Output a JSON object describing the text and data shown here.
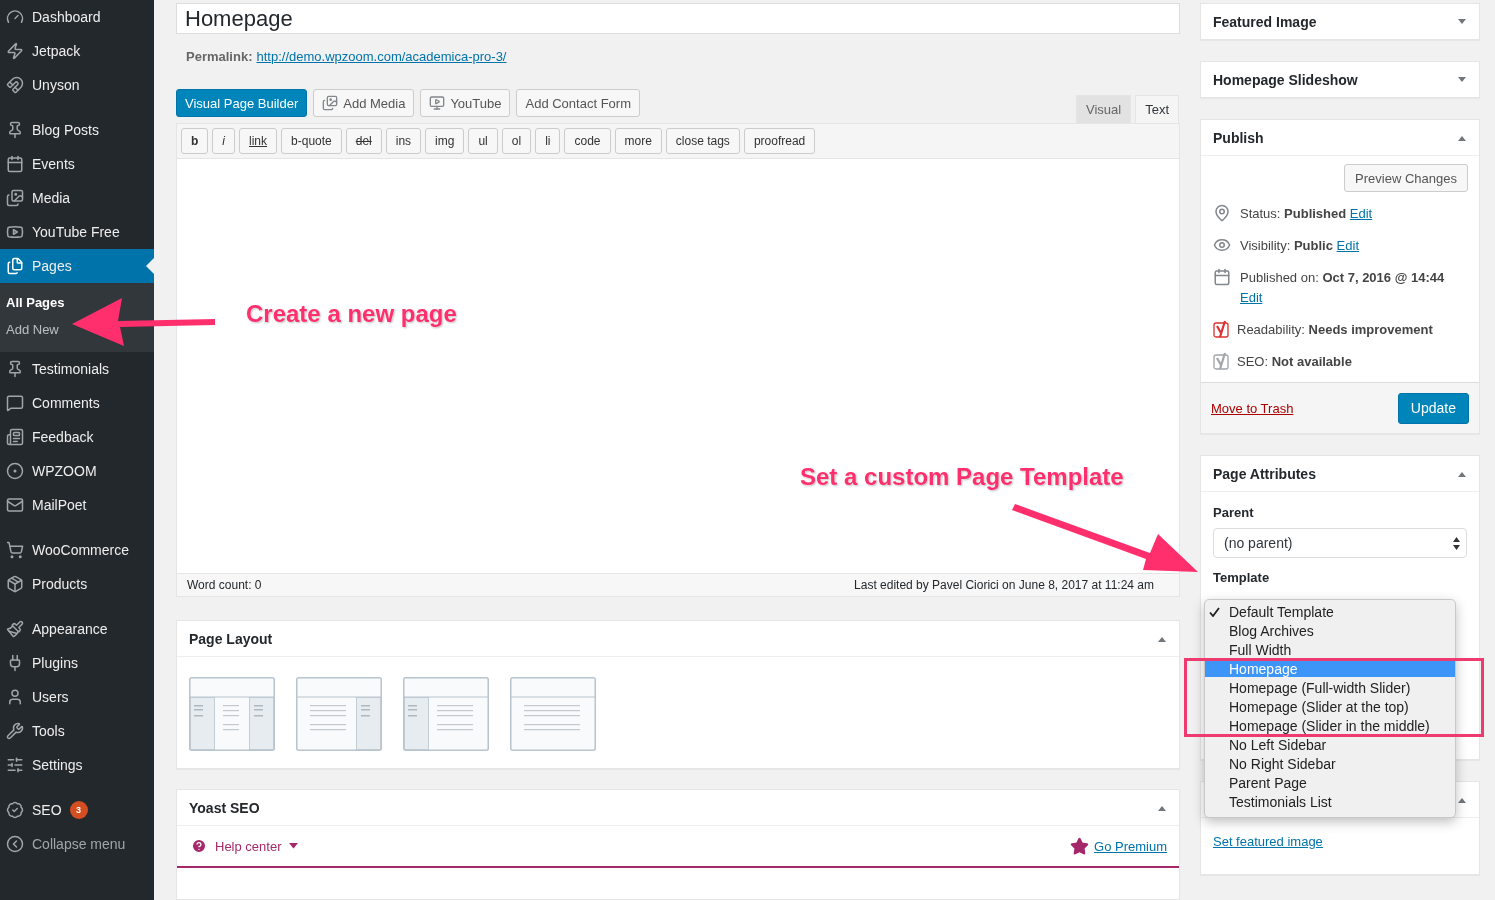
{
  "sidebar": {
    "groups": [
      [
        {
          "label": "Dashboard",
          "selected": false
        },
        {
          "label": "Jetpack",
          "selected": false
        },
        {
          "label": "Unyson",
          "selected": false
        }
      ],
      [
        {
          "label": "Blog Posts",
          "selected": false
        },
        {
          "label": "Events",
          "selected": false
        },
        {
          "label": "Media",
          "selected": false
        },
        {
          "label": "YouTube Free",
          "selected": false
        },
        {
          "label": "Pages",
          "selected": true,
          "children": [
            {
              "label": "All Pages",
              "selected": true
            },
            {
              "label": "Add New",
              "selected": false
            }
          ]
        },
        {
          "label": "Testimonials",
          "selected": false
        },
        {
          "label": "Comments",
          "selected": false
        },
        {
          "label": "Feedback",
          "selected": false
        },
        {
          "label": "WPZOOM",
          "selected": false
        },
        {
          "label": "MailPoet",
          "selected": false
        }
      ],
      [
        {
          "label": "WooCommerce",
          "selected": false
        },
        {
          "label": "Products",
          "selected": false
        }
      ],
      [
        {
          "label": "Appearance",
          "selected": false
        },
        {
          "label": "Plugins",
          "selected": false
        },
        {
          "label": "Users",
          "selected": false
        },
        {
          "label": "Tools",
          "selected": false
        },
        {
          "label": "Settings",
          "selected": false
        }
      ],
      [
        {
          "label": "SEO",
          "selected": false,
          "badge": "3"
        }
      ]
    ],
    "collapse": "Collapse menu"
  },
  "editor": {
    "title_value": "Homepage",
    "permalink_label": "Permalink:",
    "permalink_url": "http://demo.wpzoom.com/academica-pro-3/",
    "media_buttons": [
      {
        "label": "Visual Page Builder",
        "kind": "primary"
      },
      {
        "label": "Add Media",
        "kind": "default"
      },
      {
        "label": "YouTube",
        "kind": "default"
      },
      {
        "label": "Add Contact Form",
        "kind": "default"
      }
    ],
    "tabs": [
      {
        "label": "Visual",
        "selected": false
      },
      {
        "label": "Text",
        "selected": true
      }
    ],
    "quicktags": [
      {
        "label": "b",
        "kind": "bold"
      },
      {
        "label": "i",
        "kind": "italic"
      },
      {
        "label": "link",
        "kind": "underline"
      },
      {
        "label": "b-quote",
        "kind": "plain"
      },
      {
        "label": "del",
        "kind": "strike"
      },
      {
        "label": "ins",
        "kind": "plain"
      },
      {
        "label": "img",
        "kind": "plain"
      },
      {
        "label": "ul",
        "kind": "plain"
      },
      {
        "label": "ol",
        "kind": "plain"
      },
      {
        "label": "li",
        "kind": "plain"
      },
      {
        "label": "code",
        "kind": "plain"
      },
      {
        "label": "more",
        "kind": "plain"
      },
      {
        "label": "close tags",
        "kind": "plain"
      },
      {
        "label": "proofread",
        "kind": "plain"
      }
    ],
    "word_count": "Word count: 0",
    "last_edited": "Last edited by Pavel Ciorici on June 8, 2017 at 11:24 am"
  },
  "page_layout": {
    "title": "Page Layout",
    "expanded": true,
    "options": [
      {
        "kind": "both"
      },
      {
        "kind": "right"
      },
      {
        "kind": "left"
      },
      {
        "kind": "none"
      }
    ]
  },
  "yoast": {
    "title": "Yoast SEO",
    "expanded": true,
    "help": "Help center",
    "premium": "Go Premium"
  },
  "featured_image": {
    "title": "Featured Image",
    "expanded": false
  },
  "slideshow": {
    "title": "Homepage Slideshow",
    "expanded": false
  },
  "publish": {
    "title": "Publish",
    "expanded": true,
    "preview": "Preview Changes",
    "rows": [
      {
        "kind": "meta",
        "text": "Status: **Published**",
        "link": "Edit"
      },
      {
        "kind": "meta",
        "text": "Visibility: **Public**",
        "link": "Edit"
      },
      {
        "kind": "meta",
        "text": "Published on: **Oct 7, 2016 @ 14:44**",
        "link": "Edit"
      },
      {
        "kind": "score",
        "text": "Readability: **Needs improvement**",
        "color": "#dc3232"
      },
      {
        "kind": "score",
        "text": "SEO: **Not available**",
        "color": "#a0a5aa"
      }
    ],
    "trash": "Move to Trash",
    "update": "Update"
  },
  "page_attributes": {
    "title": "Page Attributes",
    "expanded": true,
    "parent_label": "Parent",
    "parent_value": "(no parent)",
    "template_label": "Template",
    "template_options": [
      {
        "label": "Default Template",
        "checked": true,
        "selected": false
      },
      {
        "label": "Blog Archives",
        "checked": false,
        "selected": false
      },
      {
        "label": "Full Width",
        "checked": false,
        "selected": false
      },
      {
        "label": "Homepage",
        "checked": false,
        "selected": true
      },
      {
        "label": "Homepage (Full-width Slider)",
        "checked": false,
        "selected": false
      },
      {
        "label": "Homepage (Slider at the top)",
        "checked": false,
        "selected": false
      },
      {
        "label": "Homepage (Slider in the middle)",
        "checked": false,
        "selected": false
      },
      {
        "label": "No Left Sidebar",
        "checked": false,
        "selected": false
      },
      {
        "label": "No Right Sidebar",
        "checked": false,
        "selected": false
      },
      {
        "label": "Parent Page",
        "checked": false,
        "selected": false
      },
      {
        "label": "Testimonials List",
        "checked": false,
        "selected": false
      }
    ]
  },
  "image_box": {
    "expanded": true,
    "link": "Set featured image"
  },
  "annotations": [
    {
      "text": "Create a new page"
    },
    {
      "text": "Set a custom Page Template"
    }
  ]
}
